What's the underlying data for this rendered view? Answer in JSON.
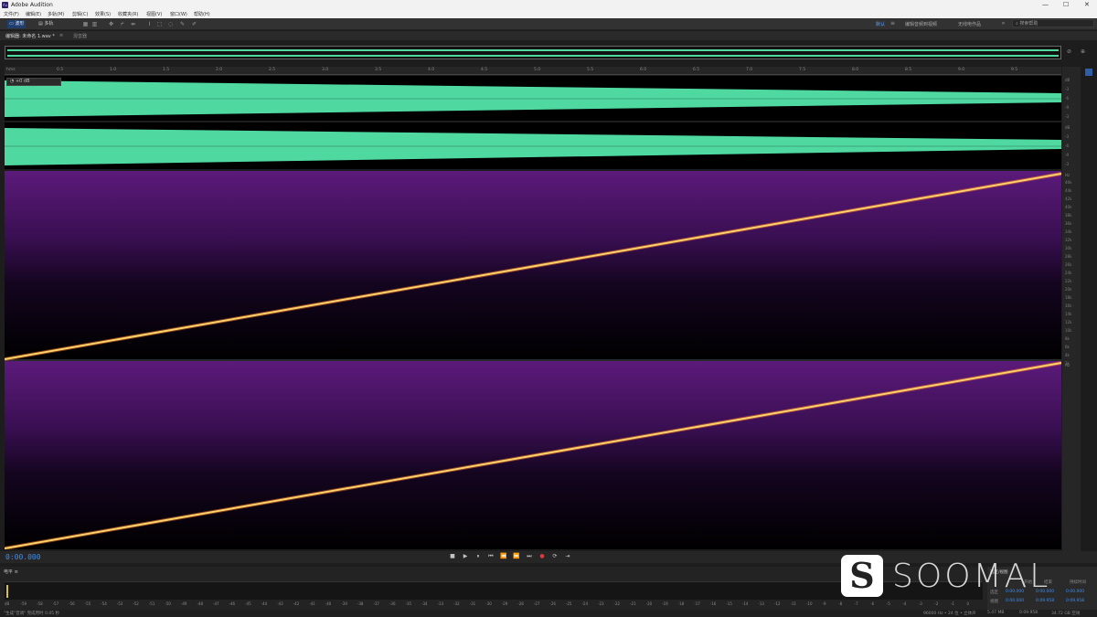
{
  "app": {
    "title": "Adobe Audition",
    "icon_label": "Au",
    "window_controls": [
      "—",
      "☐",
      "✕"
    ]
  },
  "menu": {
    "items": [
      "文件(F)",
      "编辑(E)",
      "多轨(M)",
      "剪辑(C)",
      "效果(S)",
      "收藏夹(R)",
      "视图(V)",
      "窗口(W)",
      "帮助(H)"
    ]
  },
  "toolbar": {
    "waveform_label": "波形",
    "multitrack_label": "多轨",
    "workspaces": [
      "默认",
      "编辑音频到视频",
      "无线电作品"
    ],
    "active_workspace": "默认",
    "search_placeholder": "搜索帮助"
  },
  "editor": {
    "tab_label": "编辑器: 未命名 1.wav *",
    "mixer_label": "混音器",
    "hud_gain": "+0 dB"
  },
  "ruler": {
    "labels": [
      "hms",
      "0.5",
      "1.0",
      "1.5",
      "2.0",
      "2.5",
      "3.0",
      "3.5",
      "4.0",
      "4.5",
      "5.0",
      "5.5",
      "6.0",
      "6.5",
      "7.0",
      "7.5",
      "8.0",
      "8.5",
      "9.0",
      "9.5"
    ]
  },
  "amplitude_scale": {
    "labels": [
      "dB",
      "-3",
      "-6",
      "-9",
      "-3",
      "dB",
      "-3",
      "-6",
      "-9",
      "-3"
    ]
  },
  "frequency_scale": {
    "labels": [
      "Hz",
      "46k",
      "44k",
      "42k",
      "40k",
      "38k",
      "36k",
      "34k",
      "32k",
      "30k",
      "28k",
      "26k",
      "24k",
      "22k",
      "20k",
      "18k",
      "16k",
      "14k",
      "12k",
      "10k",
      "8k",
      "6k",
      "4k",
      "2k",
      "Hz"
    ]
  },
  "transport": {
    "time": "0:00.000",
    "buttons": [
      "■",
      "▶",
      "⏸",
      "⏮",
      "⏪",
      "⏩",
      "⏭",
      "●",
      "⟳",
      "⇥"
    ]
  },
  "levels": {
    "header": "电平",
    "db_labels": [
      "dB",
      "-59",
      "-58",
      "-57",
      "-56",
      "-55",
      "-54",
      "-53",
      "-52",
      "-51",
      "-50",
      "-49",
      "-48",
      "-47",
      "-46",
      "-45",
      "-44",
      "-43",
      "-42",
      "-41",
      "-40",
      "-39",
      "-38",
      "-37",
      "-36",
      "-35",
      "-34",
      "-33",
      "-32",
      "-31",
      "-30",
      "-29",
      "-28",
      "-27",
      "-26",
      "-25",
      "-24",
      "-23",
      "-22",
      "-21",
      "-20",
      "-19",
      "-18",
      "-17",
      "-16",
      "-15",
      "-14",
      "-13",
      "-12",
      "-11",
      "-10",
      "-9",
      "-8",
      "-7",
      "-6",
      "-5",
      "-4",
      "-3",
      "-2",
      "-1",
      "0"
    ]
  },
  "selection": {
    "header": "选区/视图",
    "col_start": "开始",
    "col_end": "结束",
    "col_duration": "持续时间",
    "row_selection": "选区",
    "row_view": "视图",
    "sel_start": "0:00.000",
    "sel_end": "0:00.000",
    "sel_dur": "0:00.000",
    "view_start": "0:00.000",
    "view_end": "0:09.958",
    "view_dur": "0:09.958"
  },
  "status": {
    "left": "\"生成\"音调\" 完成用时 0.05 秒",
    "sample_info": "96000 Hz • 24 位 • 立体声",
    "file_size": "5.47 MB",
    "duration": "0:09.958",
    "free_space": "34.72 GB 空闲"
  },
  "watermark": {
    "logo_glyph": "S",
    "text": "SOOMAL"
  },
  "colors": {
    "waveform": "#4fd9a0",
    "spectral_bg_top": "#5b1a7a",
    "sweep_line": "#ffd36a",
    "accent": "#3e8ef0"
  }
}
